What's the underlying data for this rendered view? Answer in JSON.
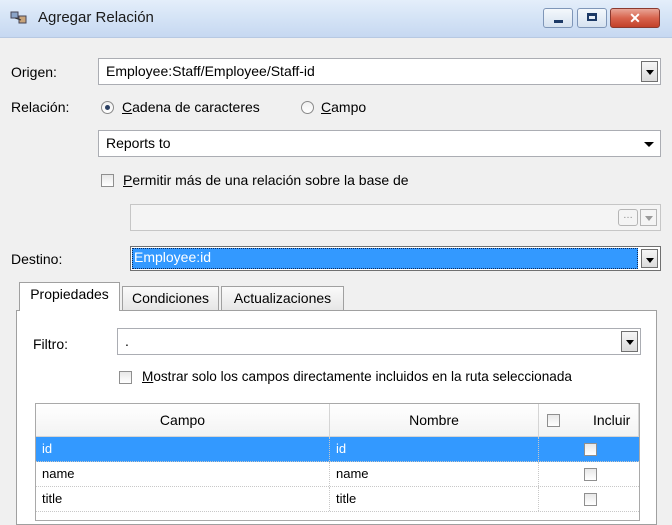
{
  "window": {
    "title": "Agregar Relación"
  },
  "origen": {
    "label": "Origen:",
    "value": "Employee:Staff/Employee/Staff-id"
  },
  "relacion": {
    "label": "Relación:",
    "radio_string_label": "Cadena de caracteres",
    "radio_field_label": "Campo",
    "selected": "string",
    "value": "Reports to"
  },
  "permitir": {
    "label": "Permitir más de una relación sobre la base de",
    "checked": false,
    "value": ""
  },
  "destino": {
    "label": "Destino:",
    "value": "Employee:id"
  },
  "tabs": [
    {
      "label": "Propiedades",
      "active": true
    },
    {
      "label": "Condiciones",
      "active": false
    },
    {
      "label": "Actualizaciones",
      "active": false
    }
  ],
  "filtro": {
    "label": "Filtro:",
    "value": "."
  },
  "mostrar": {
    "label": "Mostrar solo los campos directamente incluidos en la ruta seleccionada",
    "checked": false
  },
  "grid": {
    "headers": {
      "campo": "Campo",
      "nombre": "Nombre",
      "incluir": "Incluir"
    },
    "rows": [
      {
        "campo": "id",
        "nombre": "id",
        "incluir": false,
        "selected": true
      },
      {
        "campo": "name",
        "nombre": "name",
        "incluir": false,
        "selected": false
      },
      {
        "campo": "title",
        "nombre": "title",
        "incluir": false,
        "selected": false
      }
    ]
  },
  "colors": {
    "selection": "#3399ff",
    "titlebar": "#d4e3f6",
    "close": "#c2412a"
  }
}
